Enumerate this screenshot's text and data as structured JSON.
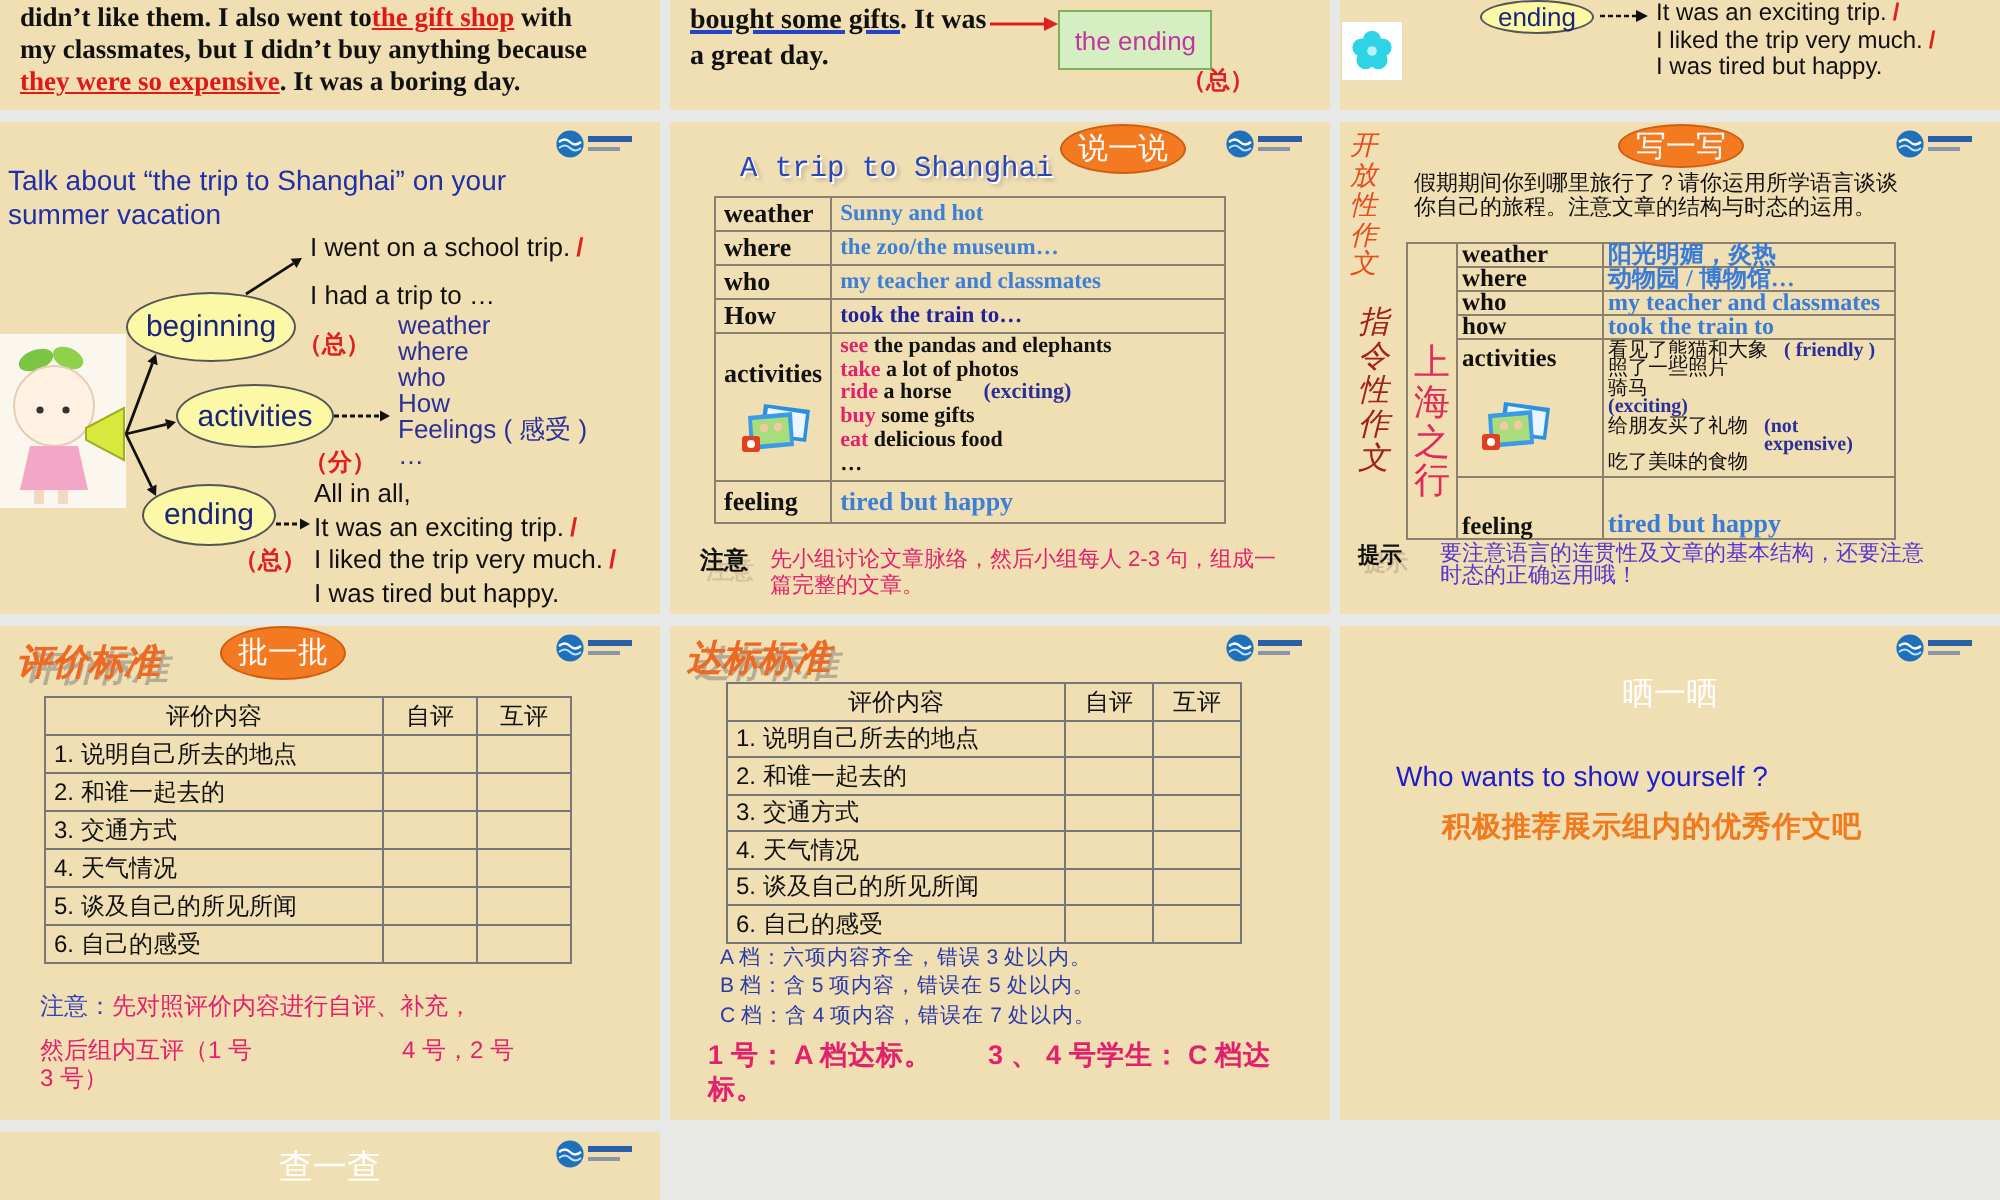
{
  "slides": [
    {
      "kind": "story",
      "lines": [
        [
          {
            "kind": "plain",
            "text": "didn’t like them. I also went to"
          },
          {
            "kind": "highlight",
            "text": "the gift shop"
          },
          {
            "kind": "plain",
            "text": " with"
          }
        ],
        [
          {
            "kind": "plain",
            "text": "my classmates, but I didn’t buy anything because"
          }
        ],
        [
          {
            "kind": "highlight",
            "text": "they were so expensive"
          },
          {
            "kind": "plain",
            "text": ". It was a boring day."
          }
        ]
      ]
    },
    {
      "kind": "story_ending",
      "lines": [
        [
          {
            "kind": "underlined",
            "text": "bought some gifts"
          },
          {
            "kind": "plain",
            "text": ". It was"
          }
        ],
        [
          {
            "kind": "plain",
            "text": "a great day."
          }
        ]
      ],
      "callout": "the ending",
      "mark": "（总）"
    },
    {
      "kind": "ending_excerpt",
      "node": "ending",
      "lines": [
        {
          "text": "It was an exciting trip.",
          "slash": "/"
        },
        {
          "text": "I liked the trip very much.",
          "slash": "/"
        },
        {
          "text": "I was tired but happy."
        }
      ]
    },
    {
      "kind": "mind_map",
      "title": "Talk about “the trip to Shanghai” on your summer vacation",
      "branches": [
        {
          "label": "beginning",
          "mark": "（总）",
          "kind": "sentences",
          "lines": [
            {
              "text": "I went on a school trip.",
              "slash": "/"
            },
            {
              "text": "I had a trip to …"
            }
          ]
        },
        {
          "label": "activities",
          "mark": "（分）",
          "kind": "topics",
          "lines": [
            {
              "text": "weather"
            },
            {
              "text": "where"
            },
            {
              "text": "who"
            },
            {
              "text": "How"
            },
            {
              "text": "Feelings ( 感受 )"
            },
            {
              "text": "…"
            }
          ]
        },
        {
          "label": "ending",
          "mark": "（总）",
          "kind": "sentences",
          "lines": [
            {
              "text": "All in all,"
            },
            {
              "text": "It was an exciting trip.",
              "slash": "/"
            },
            {
              "text": "I liked the trip very much.",
              "slash": "/"
            },
            {
              "text": "I was tired but happy."
            }
          ]
        }
      ]
    },
    {
      "kind": "talk_table",
      "title": "A trip to Shanghai",
      "tag": "说一说",
      "rows": [
        {
          "kind": "text",
          "label": "weather",
          "value": "Sunny and hot",
          "color": "#3b7fd6"
        },
        {
          "kind": "text",
          "label": "where",
          "value": "the zoo/the museum…",
          "color": "#3b7fd6"
        },
        {
          "kind": "text",
          "label": "who",
          "value": "my teacher and classmates",
          "color": "#3b7fd6"
        },
        {
          "kind": "text",
          "label": "How",
          "value": "took the train to…",
          "color": "#22229c"
        },
        {
          "kind": "list",
          "label": "activities",
          "items": [
            {
              "verb": "see",
              "rest": "the pandas and elephants"
            },
            {
              "verb": "take",
              "rest": "a lot of photos"
            },
            {
              "verb": "ride",
              "rest": "a horse",
              "note": "(exciting)"
            },
            {
              "verb": "buy",
              "rest": "some gifts"
            },
            {
              "verb": "eat",
              "rest": "delicious food"
            },
            {
              "rest": "…"
            }
          ]
        },
        {
          "kind": "text",
          "label": "feeling",
          "value": "tired but happy",
          "color": "#3b7fd6"
        }
      ],
      "note_label": "注意",
      "note": "先小组讨论文章脉络，然后小组每人 2-3 句，组成一篇完整的文章。"
    },
    {
      "kind": "writing_task",
      "side_labels": [
        "开放性作文",
        "指令性作文"
      ],
      "tag": "写一写",
      "prompt": "假期期间你到哪里旅行了？请你运用所学语言谈谈你自己的旅程。注意文章的结构与时态的运用。",
      "table_title": "上海之行",
      "rows": [
        {
          "kind": "text",
          "label": "weather",
          "value": "阳光明媚，炎热"
        },
        {
          "kind": "text",
          "label": "where",
          "value": "动物园 / 博物馆…"
        },
        {
          "kind": "text",
          "label": "who",
          "value": "my teacher and classmates"
        },
        {
          "kind": "text",
          "label": "how",
          "value": "took the train to"
        },
        {
          "kind": "list",
          "label": "activities",
          "items": [
            {
              "text": "看见了熊猫和大象",
              "note": "( friendly )"
            },
            {
              "text": "照了一些照片"
            },
            {
              "text": "骑马"
            },
            {
              "note": "(exciting)"
            },
            {
              "text": "给朋友买了礼物",
              "note": "(not expensive)"
            },
            {
              "text": "吃了美味的食物"
            }
          ]
        },
        {
          "kind": "text",
          "label": "feeling",
          "value": "tired but happy"
        }
      ],
      "tip_label": "提示",
      "tip": "要注意语言的连贯性及文章的基本结构，还要注意时态的正确运用哦！"
    },
    {
      "kind": "checklist",
      "heading": "评价标准",
      "tag": "批一批",
      "columns": [
        "评价内容",
        "自评",
        "互评"
      ],
      "rows": [
        "1. 说明自己所去的地点",
        "2. 和谁一起去的",
        "3. 交通方式",
        "4. 天气情况",
        "5. 谈及自己的所见所闻",
        "6. 自己的感受"
      ],
      "note_label": "注意：",
      "note": "先对照评价内容进行自评、补充，",
      "note_lines": [
        [
          "然后组内互评（1 号",
          "4 号，2 号"
        ],
        [
          "3 号）"
        ]
      ]
    },
    {
      "kind": "checklist",
      "heading": "达标标准",
      "columns": [
        "评价内容",
        "自评",
        "互评"
      ],
      "rows": [
        "1. 说明自己所去的地点",
        "2. 和谁一起去的",
        "3. 交通方式",
        "4. 天气情况",
        "5. 谈及自己的所见所闻",
        "6. 自己的感受"
      ],
      "levels": [
        "A 档：六项内容齐全，错误 3 处以内。",
        "B 档：含 5 项内容，错误在 5 处以内。",
        "C 档：含 4 项内容，错误在 7 处以内。"
      ],
      "result": "1 号： A 档达标。　　3 、 4 号学生： C 档达标。"
    },
    {
      "kind": "showcase",
      "heading": "晒一晒",
      "question": "Who wants to show yourself ?",
      "prompt": "积极推荐展示组内的优秀作文吧"
    },
    {
      "kind": "title",
      "heading": "查一查"
    }
  ]
}
